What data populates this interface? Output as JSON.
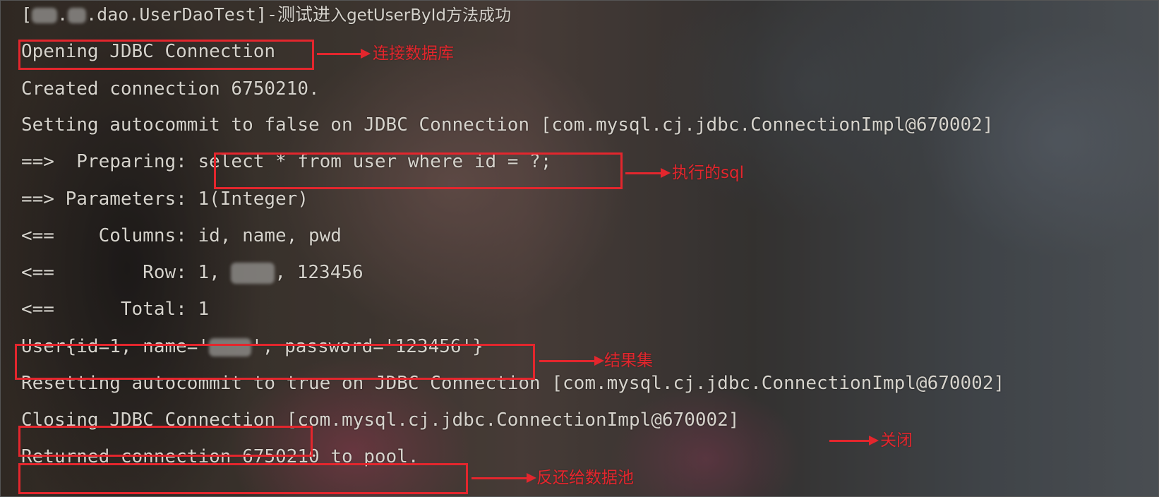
{
  "log": {
    "header_prefix": "[",
    "header_dot": ".",
    "header_class": ".dao.UserDaoTest]-测试进",
    "header_method": "入getUserById方法成功",
    "line1": "Opening JDBC Connection",
    "line2": "Created connection 6750210.",
    "line3": "Setting autocommit to false on JDBC Connection [com.mysql.cj.jdbc.ConnectionImpl@670002]",
    "line4_prefix": "==>  Preparing: ",
    "line4_sql": "select * from user where id = ?;",
    "line5": "==> Parameters: 1(Integer)",
    "line6": "<==    Columns: id, name, pwd",
    "line7_prefix": "<==        Row: 1, ",
    "line7_suffix": ", 123456",
    "line8": "<==      Total: 1",
    "line9_prefix": "User{id=1, name='",
    "line9_suffix": "', password='123456'}",
    "line10": "Resetting autocommit to true on JDBC Connection [com.mysql.cj.jdbc.ConnectionImpl@670002]",
    "line11_prefix": "Closing JDBC Connection",
    "line11_suffix": " [com.mysql.cj.jdbc.ConnectionImpl@670002]",
    "line12": "Returned connection 6750210 to pool."
  },
  "annotations": {
    "connect_db": "连接数据库",
    "executed_sql": "执行的sql",
    "result_set": "结果集",
    "close": "关闭",
    "return_pool": "反还给数据池"
  },
  "colors": {
    "text": "#d6d3cc",
    "annotation": "#e3262d"
  }
}
